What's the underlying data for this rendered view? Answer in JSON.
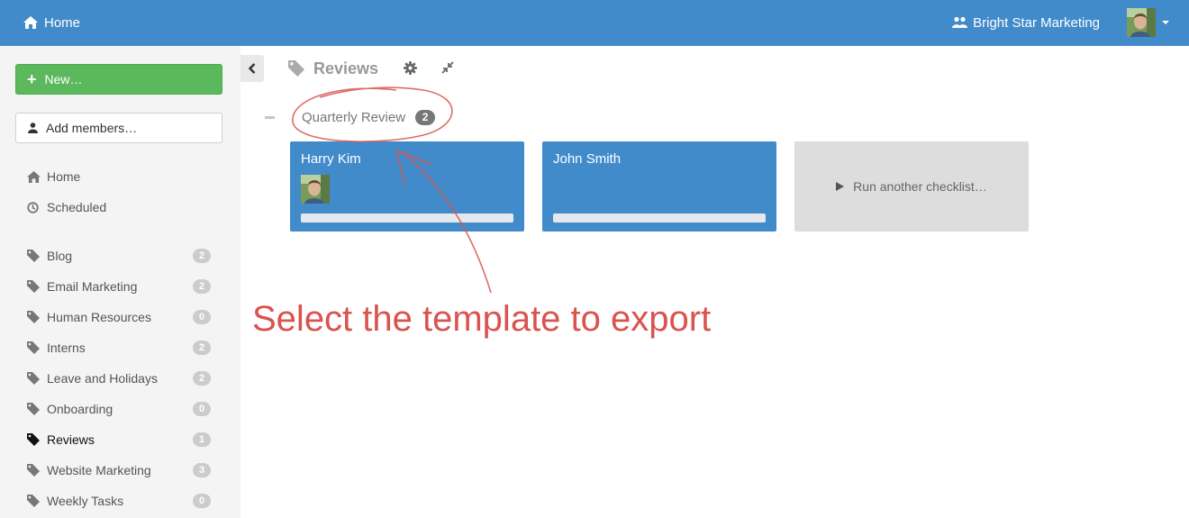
{
  "topbar": {
    "home_label": "Home",
    "org_name": "Bright Star Marketing"
  },
  "sidebar": {
    "new_label": "New…",
    "add_members_label": "Add members…",
    "nav": [
      {
        "label": "Home",
        "icon": "home-icon"
      },
      {
        "label": "Scheduled",
        "icon": "clock-icon"
      }
    ],
    "tags": [
      {
        "label": "Blog",
        "count": "2"
      },
      {
        "label": "Email Marketing",
        "count": "2"
      },
      {
        "label": "Human Resources",
        "count": "0"
      },
      {
        "label": "Interns",
        "count": "2"
      },
      {
        "label": "Leave and Holidays",
        "count": "2"
      },
      {
        "label": "Onboarding",
        "count": "0"
      },
      {
        "label": "Reviews",
        "count": "1",
        "active": true
      },
      {
        "label": "Website Marketing",
        "count": "3"
      },
      {
        "label": "Weekly Tasks",
        "count": "0"
      }
    ]
  },
  "main": {
    "title": "Reviews",
    "section": {
      "title": "Quarterly Review",
      "count": "2",
      "cards": [
        {
          "name": "Harry Kim",
          "progress": 0
        },
        {
          "name": "John Smith",
          "progress": 0
        }
      ],
      "run_label": "Run another checklist…"
    }
  },
  "annotation": {
    "text": "Select the template to export"
  },
  "colors": {
    "topbar": "#428bca",
    "new_button": "#5cb85c",
    "card": "#428bca",
    "annotation": "#d9534f"
  }
}
